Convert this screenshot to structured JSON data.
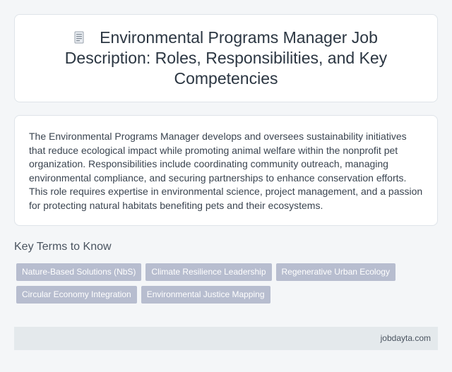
{
  "header": {
    "title": "Environmental Programs Manager Job Description: Roles, Responsibilities, and Key Competencies",
    "icon": "document-icon"
  },
  "description": {
    "text": "The Environmental Programs Manager develops and oversees sustainability initiatives that reduce ecological impact while promoting animal welfare within the nonprofit pet organization. Responsibilities include coordinating community outreach, managing environmental compliance, and securing partnerships to enhance conservation efforts. This role requires expertise in environmental science, project management, and a passion for protecting natural habitats benefiting pets and their ecosystems."
  },
  "key_terms": {
    "heading": "Key Terms to Know",
    "tags": [
      "Nature-Based Solutions (NbS)",
      "Climate Resilience Leadership",
      "Regenerative Urban Ecology",
      "Circular Economy Integration",
      "Environmental Justice Mapping"
    ]
  },
  "footer": {
    "site": "jobdayta.com"
  },
  "colors": {
    "background": "#f4f6f8",
    "card": "#ffffff",
    "tag": "#b7bdcf",
    "footer": "#e4e9ec"
  }
}
